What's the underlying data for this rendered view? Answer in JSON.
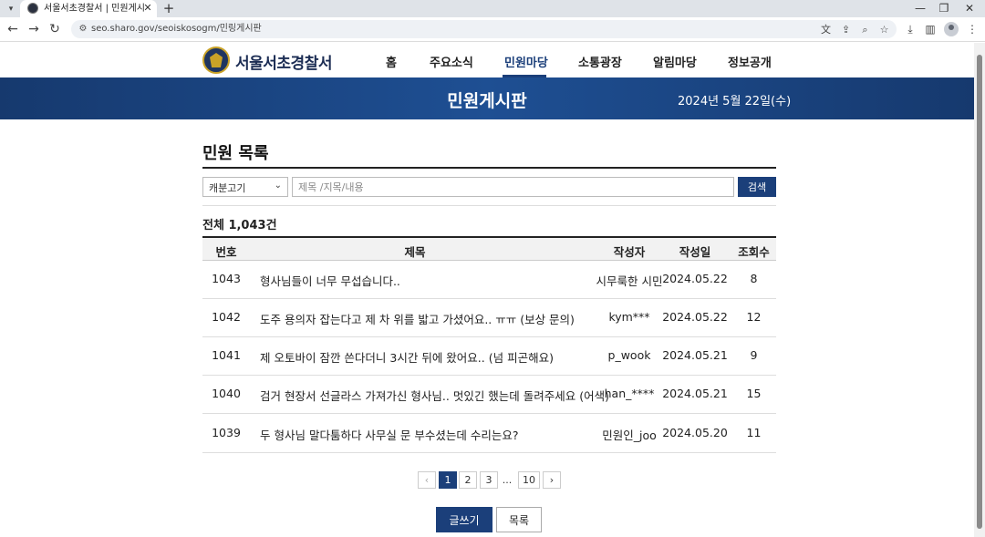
{
  "browser": {
    "tab_title": "서울서초경찰서 | 민원게시판",
    "url": "seo.sharo.gov/seoiskosogm/민링게시판",
    "icons": {
      "tab_list": "chevron-down-icon",
      "favicon": "police-emblem-icon",
      "tab_close": "close-icon",
      "new_tab": "plus-icon",
      "back": "arrow-left-icon",
      "forward": "arrow-right-icon",
      "reload": "reload-icon",
      "site_info": "tune-icon",
      "translate": "translate-icon",
      "share": "share-icon",
      "zoom": "zoom-icon",
      "bookmark": "star-icon",
      "download": "download-icon",
      "side_panel": "side-panel-icon",
      "profile": "avatar-icon",
      "menu": "more-vertical-icon"
    }
  },
  "header": {
    "logo_text": "서울서초경찰서",
    "nav": [
      {
        "label": "홈",
        "active": false
      },
      {
        "label": "주요소식",
        "active": false
      },
      {
        "label": "민원마당",
        "active": true
      },
      {
        "label": "소통광장",
        "active": false
      },
      {
        "label": "알림마당",
        "active": false
      },
      {
        "label": "정보공개",
        "active": false
      }
    ]
  },
  "banner": {
    "title": "민원게시판",
    "date": "2024년 5월 22일(수)"
  },
  "board": {
    "title": "민원 목록",
    "search": {
      "select_value": "캐분고기",
      "placeholder": "제목 /지목/내용",
      "button_label": "검색"
    },
    "total": "전체 1,043건",
    "columns": [
      "번호",
      "제목",
      "작성자",
      "작성일",
      "조회수"
    ],
    "rows": [
      {
        "num": "1043",
        "title": "형사님들이 너무 무섭습니다..",
        "author": "시무룩한 시민",
        "date": "2024.05.22",
        "views": "8"
      },
      {
        "num": "1042",
        "title": "도주 용의자 잡는다고 제 차 위를 밟고 가셨어요.. ㅠㅠ (보상 문의)",
        "author": "kym***",
        "date": "2024.05.22",
        "views": "12"
      },
      {
        "num": "1041",
        "title": "제 오토바이 잠깐 쓴다더니 3시간 뒤에 왔어요.. (넘 피곤해요)",
        "author": "p_wook",
        "date": "2024.05.21",
        "views": "9"
      },
      {
        "num": "1040",
        "title": "검거 현장서 선글라스 가져가신 형사님.. 멋있긴 했는데 돌려주세요 (어색)",
        "author": "han_****",
        "date": "2024.05.21",
        "views": "15"
      },
      {
        "num": "1039",
        "title": "두 형사님 말다툼하다 사무실 문 부수셨는데 수리는요?",
        "author": "민원인_joo",
        "date": "2024.05.20",
        "views": "11"
      }
    ],
    "pagination": {
      "prev": "‹",
      "pages": [
        "1",
        "2",
        "3"
      ],
      "dots": "...",
      "last": "10",
      "next": "›",
      "current": "1"
    },
    "write_label": "글쓰기",
    "list_label": "목록"
  }
}
